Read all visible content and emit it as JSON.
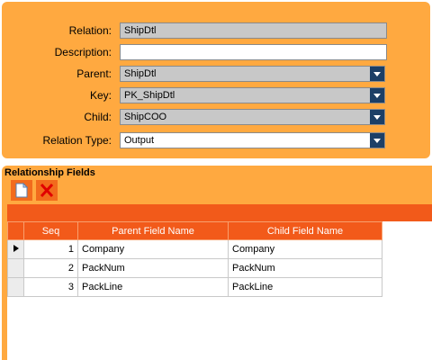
{
  "form": {
    "fields": [
      {
        "label": "Relation:",
        "value": "ShipDtl"
      },
      {
        "label": "Description:",
        "value": ""
      },
      {
        "label": "Parent:",
        "value": "ShipDtl"
      },
      {
        "label": "Key:",
        "value": "PK_ShipDtl"
      },
      {
        "label": "Child:",
        "value": "ShipCOO"
      },
      {
        "label": "Relation Type:",
        "value": "Output"
      }
    ]
  },
  "relationship": {
    "title": "Relationship Fields",
    "toolbar": {
      "new_icon": "new-document-icon",
      "delete_icon": "delete-x-icon"
    },
    "columns": [
      "Seq",
      "Parent Field Name",
      "Child Field Name"
    ],
    "rows": [
      {
        "seq": "1",
        "parent": "Company",
        "child": "Company"
      },
      {
        "seq": "2",
        "parent": "PackNum",
        "child": "PackNum"
      },
      {
        "seq": "3",
        "parent": "PackLine",
        "child": "PackLine"
      }
    ]
  },
  "colors": {
    "panel": "#ffa940",
    "header": "#f25a1a",
    "dropdown_button": "#1c3f66",
    "readonly_field": "#c8c8c8"
  }
}
